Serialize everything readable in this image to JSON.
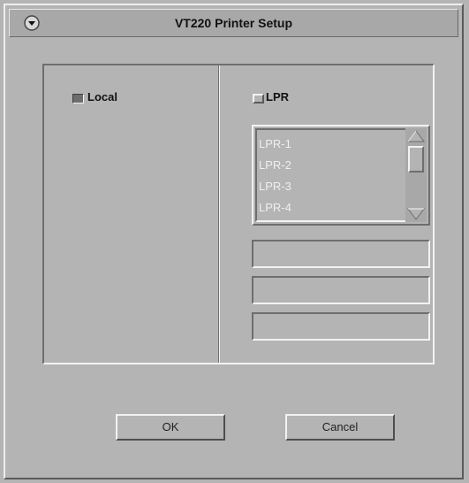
{
  "window": {
    "title": "VT220 Printer Setup"
  },
  "left_panel": {
    "local_label": "Local",
    "local_checked": true
  },
  "right_panel": {
    "lpr_label": "LPR",
    "lpr_checked": false,
    "list_items": [
      "LPR-1",
      "LPR-2",
      "LPR-3",
      "LPR-4"
    ],
    "fields": [
      "",
      "",
      ""
    ]
  },
  "buttons": {
    "ok_label": "OK",
    "cancel_label": "Cancel"
  },
  "colors": {
    "background": "#b4b4b4",
    "shadow": "#6e6e6e",
    "highlight": "#f2f2f2"
  }
}
